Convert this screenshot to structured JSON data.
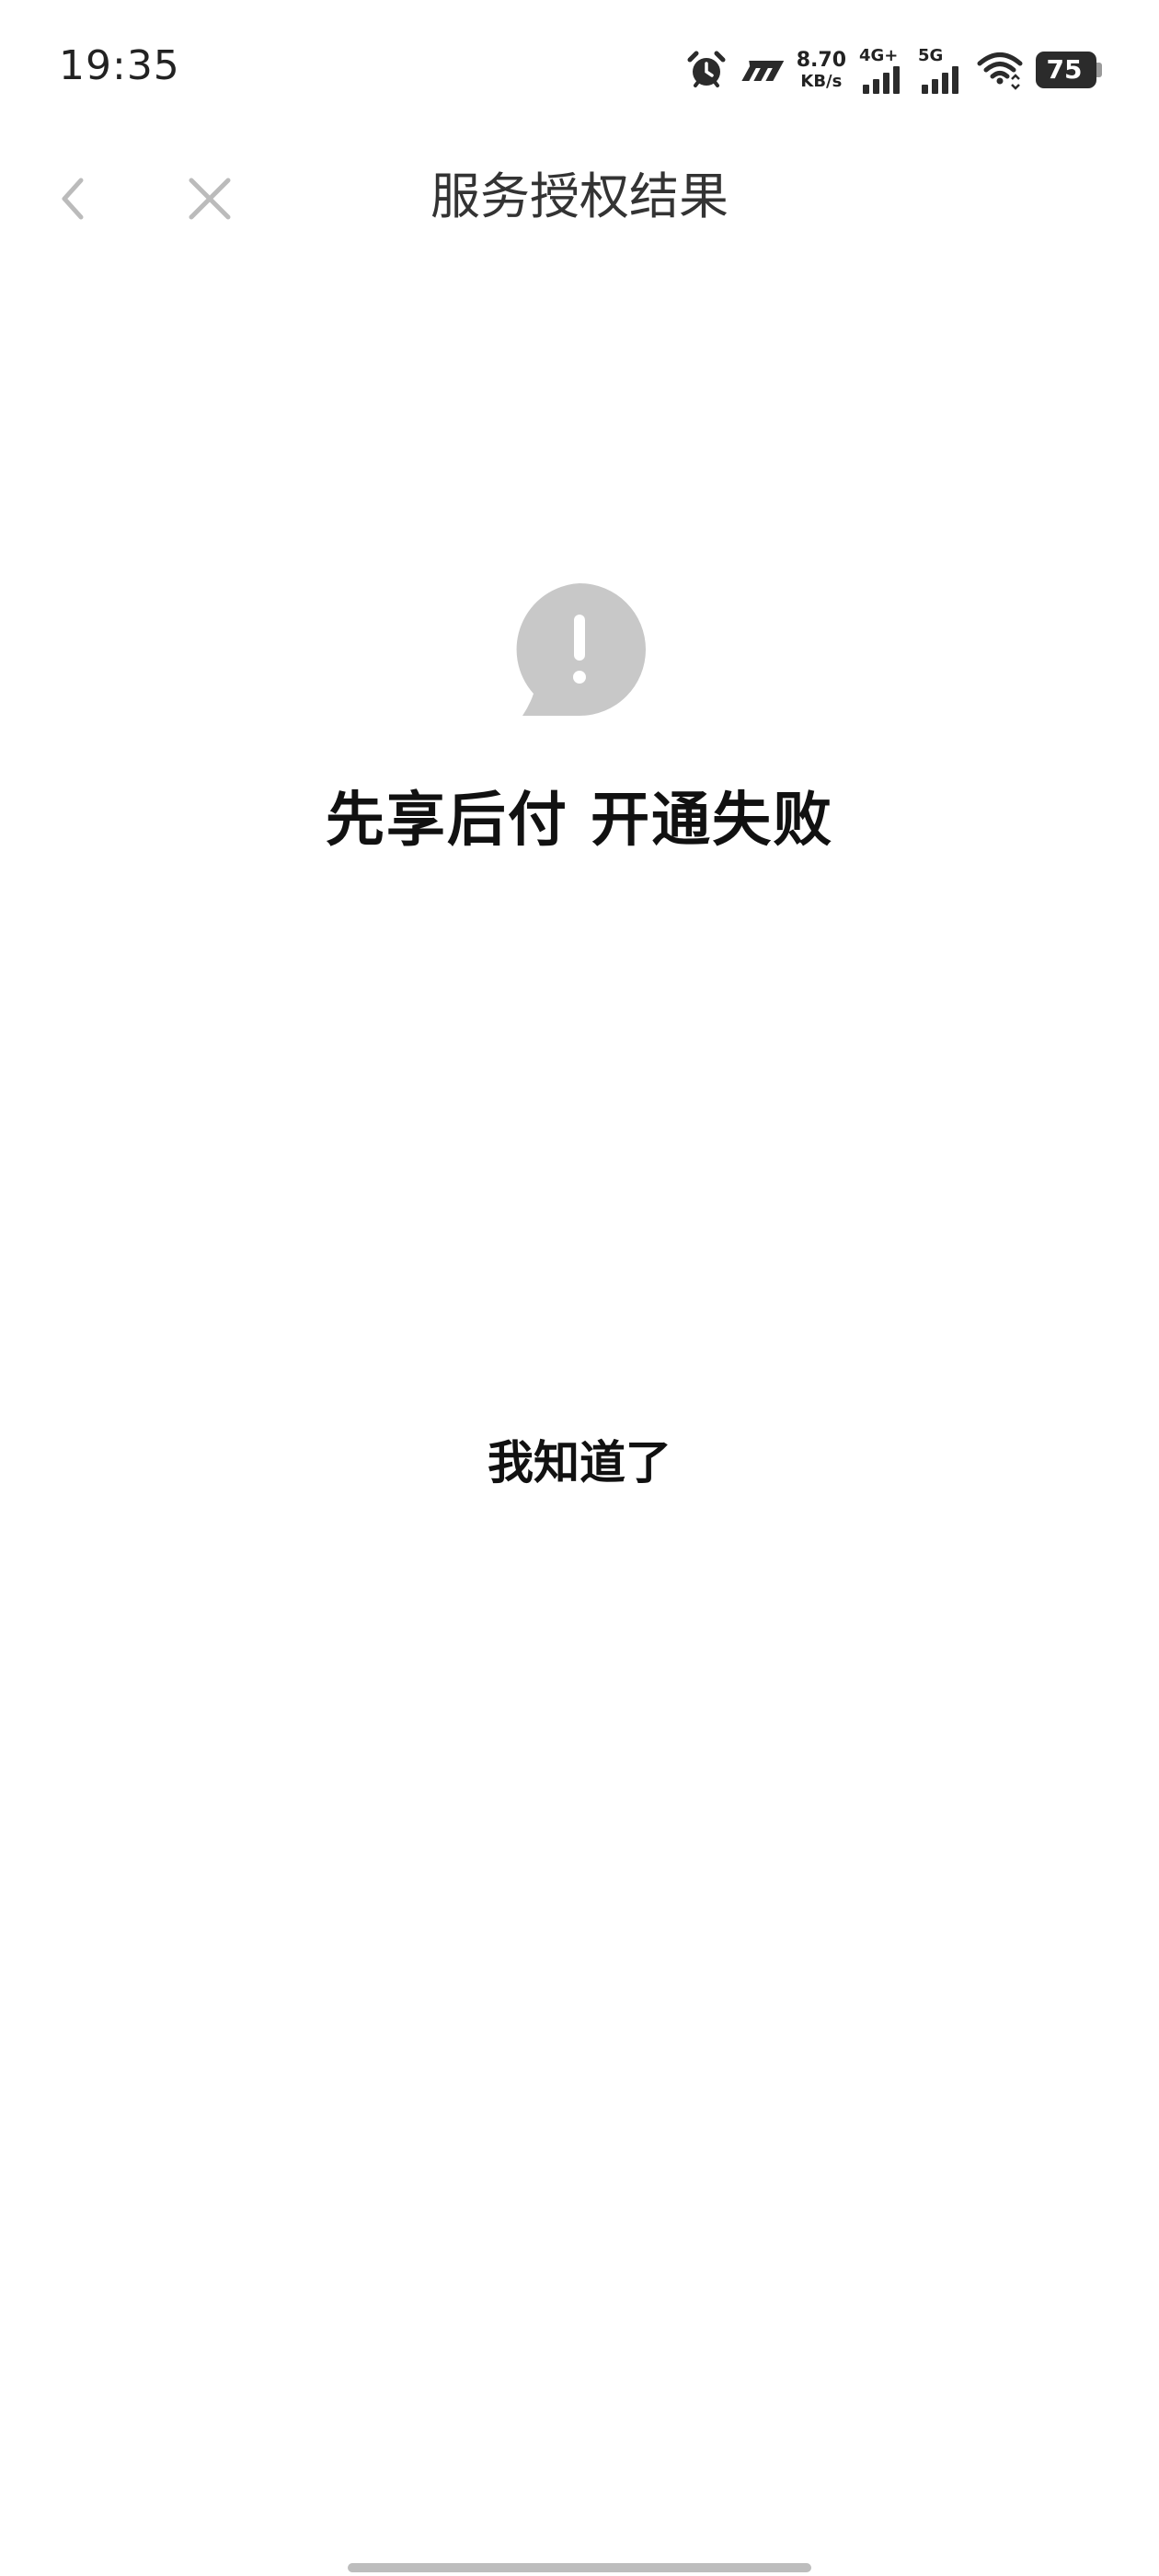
{
  "status_bar": {
    "time": "19:35",
    "net_speed_value": "8.70",
    "net_speed_unit": "KB/s",
    "signal_1_label": "4G+",
    "signal_2_label": "5G",
    "battery_percent": "75",
    "icons": [
      "alarm-icon",
      "carrier-logo-icon",
      "signal-icon",
      "signal-icon",
      "wifi-icon",
      "battery-icon"
    ]
  },
  "nav": {
    "title": "服务授权结果",
    "back_icon": "chevron-left-icon",
    "close_icon": "close-icon"
  },
  "result": {
    "icon": "exclamation-bubble-icon",
    "icon_color": "#c8c8c8",
    "title": "先享后付 开通失败",
    "button_label": "我知道了"
  }
}
